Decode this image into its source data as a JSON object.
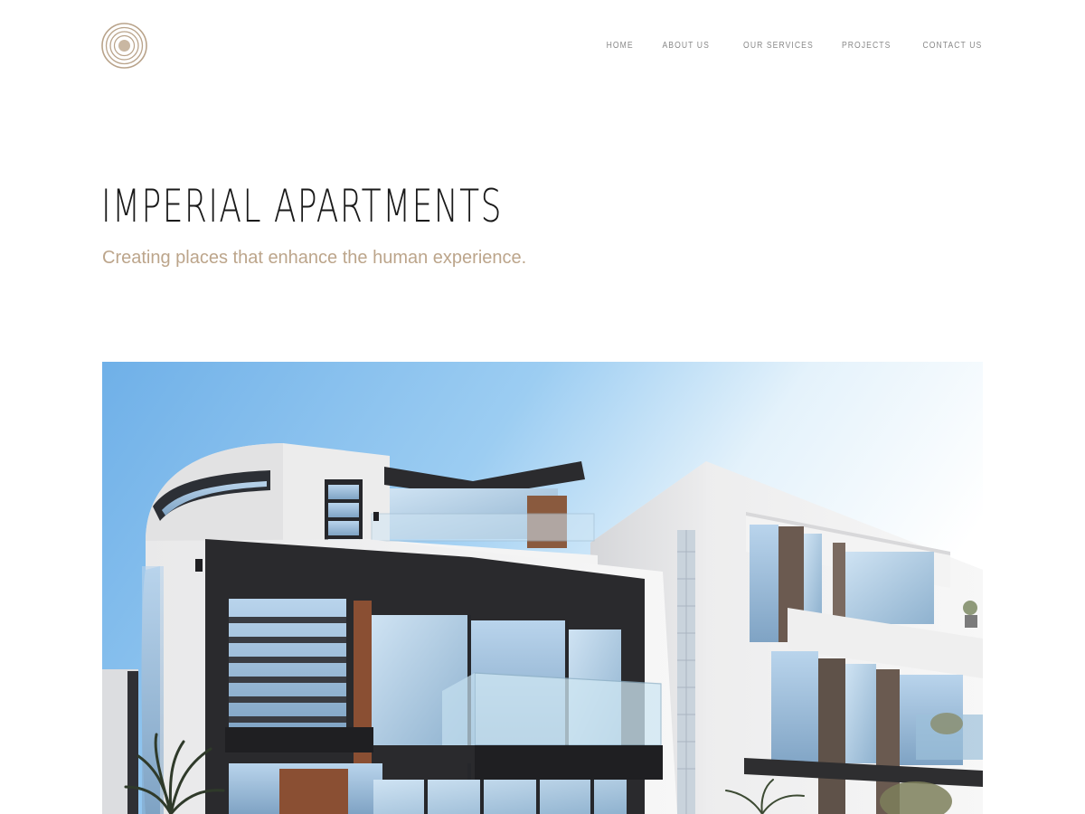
{
  "header": {
    "logo_icon": "concentric-circles-logo-icon",
    "logo_color": "#b9a38a",
    "nav": [
      {
        "label": "HOME"
      },
      {
        "label": "ABOUT US"
      },
      {
        "label": "OUR SERVICES"
      },
      {
        "label": "PROJECTS"
      },
      {
        "label": "CONTACT US"
      }
    ]
  },
  "hero": {
    "title": "IMPERIAL APARTMENTS",
    "subtitle": "Creating places that enhance the human experience.",
    "subtitle_color": "#bca58b",
    "image_subject": "modern-apartment-building-photo"
  }
}
